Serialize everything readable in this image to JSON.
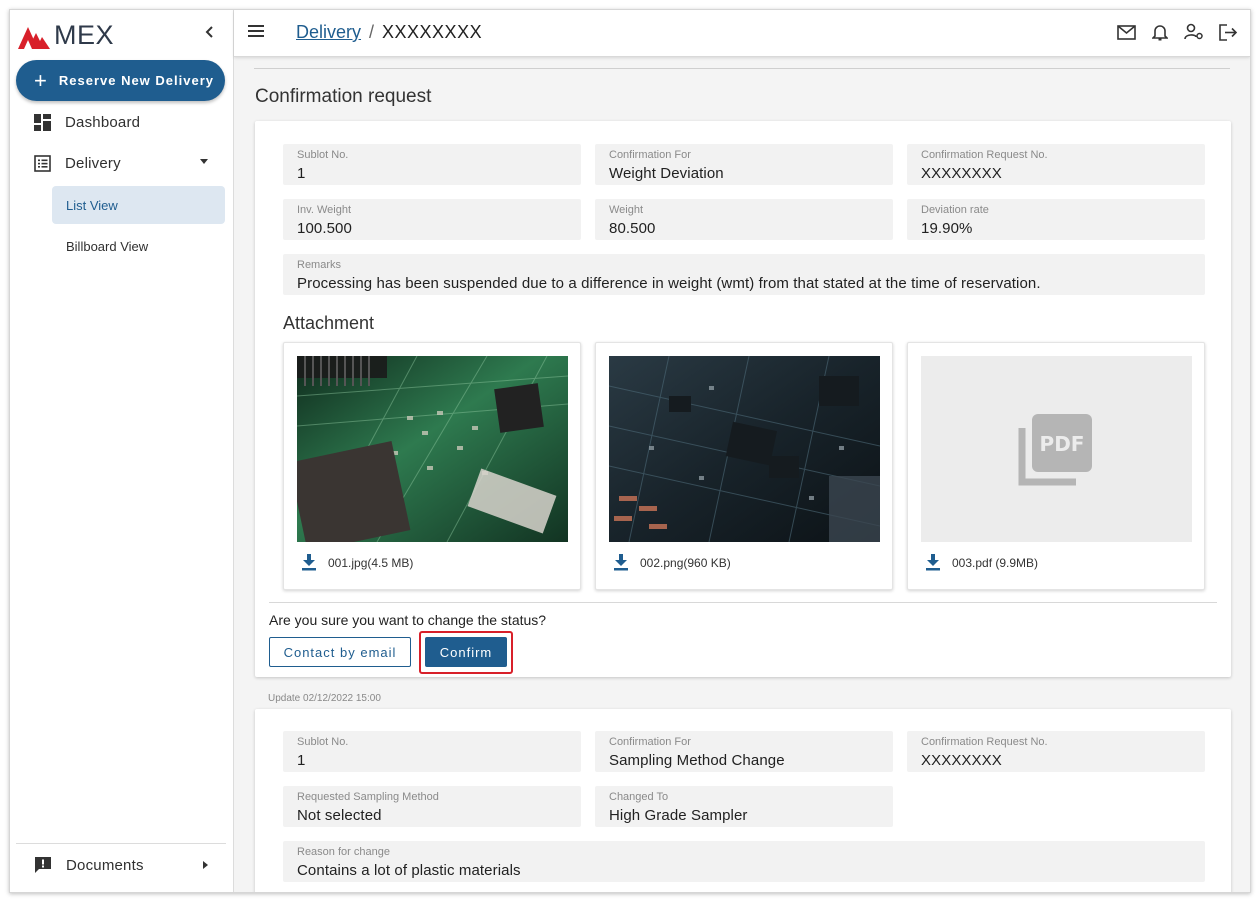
{
  "sidebar": {
    "logo_text": "MEX",
    "reserve_label": "Reserve New Delivery",
    "nav": {
      "dashboard": "Dashboard",
      "delivery": "Delivery",
      "list_view": "List View",
      "billboard_view": "Billboard View",
      "documents": "Documents"
    }
  },
  "header": {
    "breadcrumb_link": "Delivery",
    "breadcrumb_sep": "/",
    "breadcrumb_current": "XXXXXXXX"
  },
  "page": {
    "title": "Confirmation request"
  },
  "request1": {
    "sublot_label": "Sublot No.",
    "sublot_value": "1",
    "for_label": "Confirmation For",
    "for_value": "Weight Deviation",
    "req_no_label": "Confirmation Request No.",
    "req_no_value": "XXXXXXXX",
    "inv_weight_label": "Inv. Weight",
    "inv_weight_value": "100.500",
    "weight_label": "Weight",
    "weight_value": "80.500",
    "deviation_label": "Deviation rate",
    "deviation_value": "19.90%",
    "remarks_label": "Remarks",
    "remarks_value": "Processing has been suspended due to a difference in weight (wmt) from that stated at the time of reservation.",
    "attachment_title": "Attachment",
    "attachments": [
      "001.jpg(4.5 MB)",
      "002.png(960 KB)",
      "003.pdf (9.9MB)"
    ],
    "pdf_badge": "PDF",
    "question": "Are you sure you want to change the status?",
    "contact_label": "Contact by email",
    "confirm_label": "Confirm",
    "update_text": "Update 02/12/2022 15:00"
  },
  "request2": {
    "sublot_label": "Sublot No.",
    "sublot_value": "1",
    "for_label": "Confirmation For",
    "for_value": "Sampling Method Change",
    "req_no_label": "Confirmation Request No.",
    "req_no_value": "XXXXXXXX",
    "requested_label": "Requested Sampling Method",
    "requested_value": "Not selected",
    "changed_label": "Changed To",
    "changed_value": "High Grade Sampler",
    "reason_label": "Reason for change",
    "reason_value": "Contains a lot of plastic materials"
  },
  "colors": {
    "brand": "#1f5d8f",
    "logo_red": "#d8202a",
    "highlight": "#d8202a"
  },
  "icons": [
    "chevron-left-icon",
    "plus-icon",
    "dashboard-icon",
    "list-icon",
    "caret-down-icon",
    "comment-alert-icon",
    "caret-right-icon",
    "menu-icon",
    "mail-icon",
    "bell-icon",
    "user-settings-icon",
    "logout-icon",
    "download-icon",
    "pdf-icon"
  ]
}
